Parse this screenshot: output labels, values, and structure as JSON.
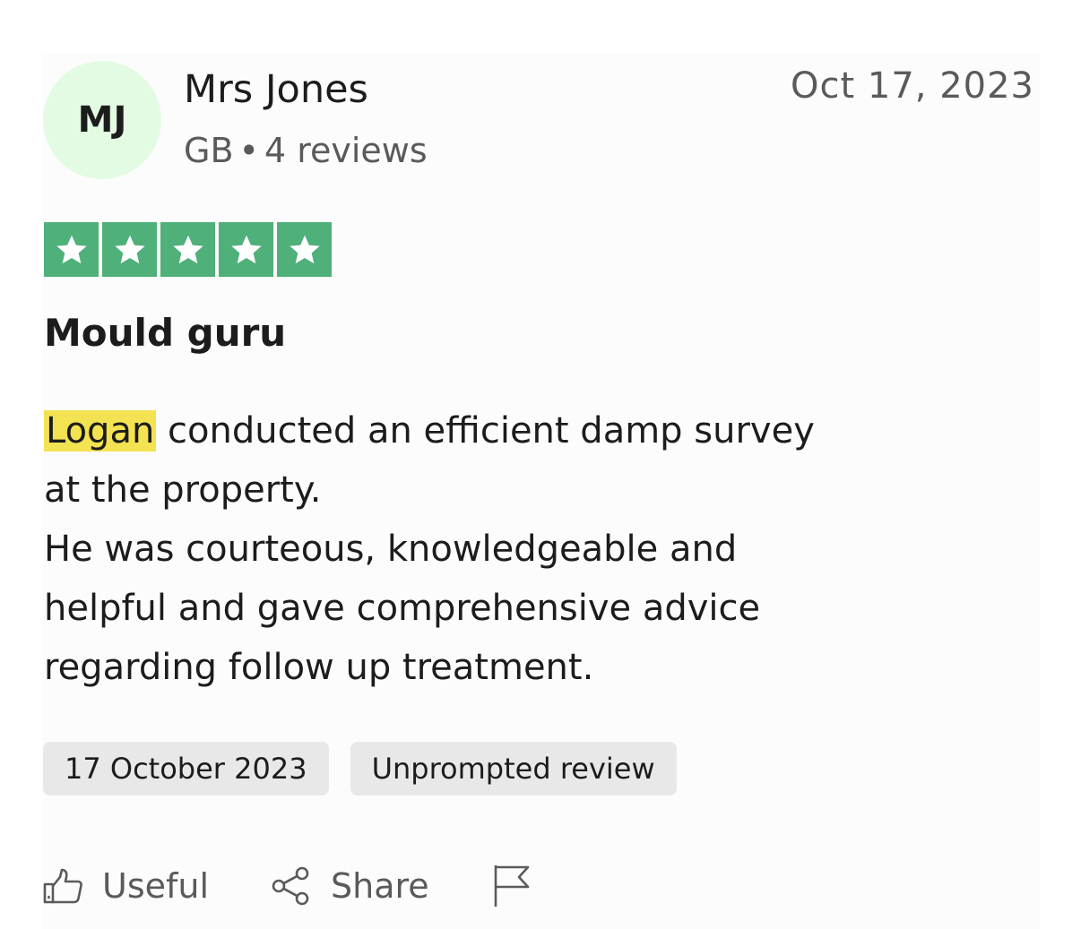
{
  "reviewer": {
    "initials": "MJ",
    "name": "Mrs Jones",
    "country": "GB",
    "separator": "•",
    "reviews_count": "4 reviews"
  },
  "review": {
    "date_header": "Oct 17, 2023",
    "rating": 5,
    "rating_max": 5,
    "star_color": "#4fb07a",
    "title": "Mould guru",
    "highlight_word": "Logan",
    "highlight_color": "#f3e251",
    "body_lines": [
      " conducted an efficient damp survey",
      "at the property.",
      "He was courteous, knowledgeable and",
      "helpful and gave comprehensive advice",
      "regarding follow up treatment."
    ]
  },
  "chips": [
    "17 October 2023",
    "Unprompted review"
  ],
  "actions": {
    "useful_label": "Useful",
    "share_label": "Share",
    "useful_icon": "thumbs-up-icon",
    "share_icon": "share-icon",
    "report_icon": "flag-icon"
  }
}
